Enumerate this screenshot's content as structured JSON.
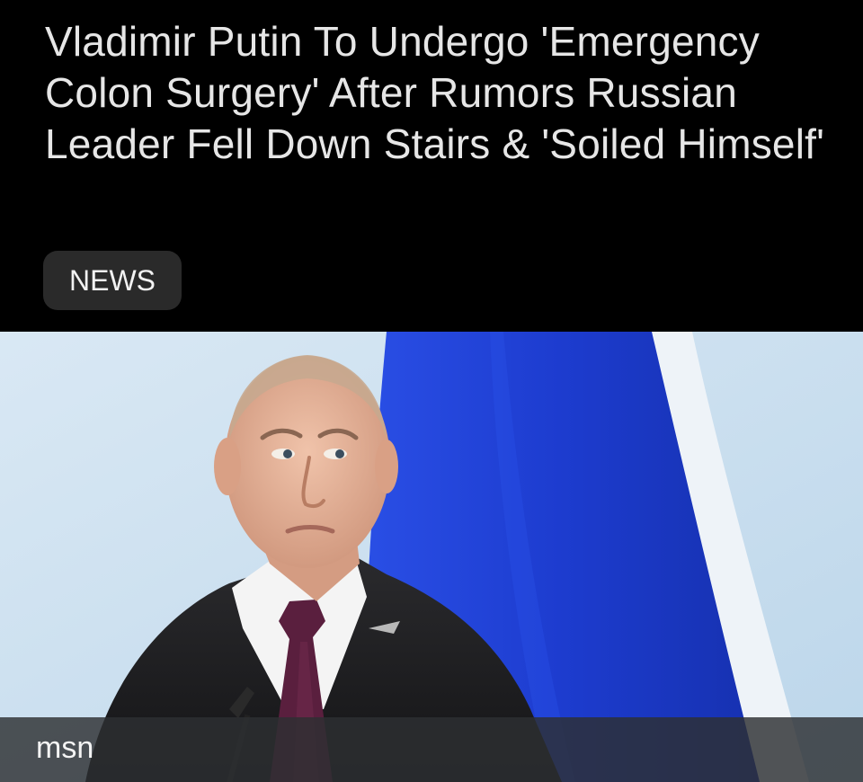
{
  "article": {
    "headline": "Vladimir Putin To Undergo 'Emergency Colon Surgery' After Rumors Russian Leader Fell Down Stairs & 'Soiled Himself'",
    "category_tag": "NEWS"
  },
  "photo": {
    "source_label": "msn"
  },
  "colors": {
    "background": "#000000",
    "headline_text": "#e6e6e6",
    "tag_background": "#2a2a2a",
    "sky": "#c9dff0",
    "flag_blue": "#1f3fd0",
    "flag_white": "#eef3f8",
    "suit": "#1c1c1e",
    "tie": "#5a1f3e",
    "skin": "#e7b49a",
    "source_bar": "#2d3032"
  }
}
